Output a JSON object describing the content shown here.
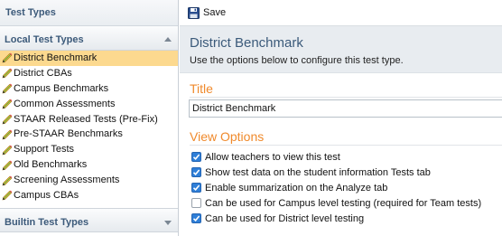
{
  "sidebar": {
    "title": "Test Types",
    "local_group": "Local Test Types",
    "builtin_group": "Builtin Test Types",
    "items": [
      {
        "label": "District Benchmark",
        "selected": true
      },
      {
        "label": "District CBAs",
        "selected": false
      },
      {
        "label": "Campus Benchmarks",
        "selected": false
      },
      {
        "label": "Common Assessments",
        "selected": false
      },
      {
        "label": "STAAR Released Tests (Pre-Fix)",
        "selected": false
      },
      {
        "label": "Pre-STAAR Benchmarks",
        "selected": false
      },
      {
        "label": "Support Tests",
        "selected": false
      },
      {
        "label": "Old Benchmarks",
        "selected": false
      },
      {
        "label": "Screening Assessments",
        "selected": false
      },
      {
        "label": "Campus CBAs",
        "selected": false
      }
    ]
  },
  "toolbar": {
    "save_label": "Save"
  },
  "header": {
    "title": "District Benchmark",
    "description": "Use the options below to configure this test type."
  },
  "title_section": {
    "heading": "Title",
    "value": "District Benchmark"
  },
  "view_options": {
    "heading": "View Options",
    "options": [
      {
        "label": "Allow teachers to view this test",
        "checked": true
      },
      {
        "label": "Show test data on the student information Tests tab",
        "checked": true
      },
      {
        "label": "Enable summarization on the Analyze tab",
        "checked": true
      },
      {
        "label": "Can be used for Campus level testing (required for Team tests)",
        "checked": false
      },
      {
        "label": "Can be used for District level testing",
        "checked": true
      }
    ]
  },
  "colors": {
    "accent_orange": "#f08a2c",
    "heading_blue": "#3b5a7a",
    "selected_row": "#fcd98f",
    "checkbox_blue": "#2f7fd8"
  }
}
